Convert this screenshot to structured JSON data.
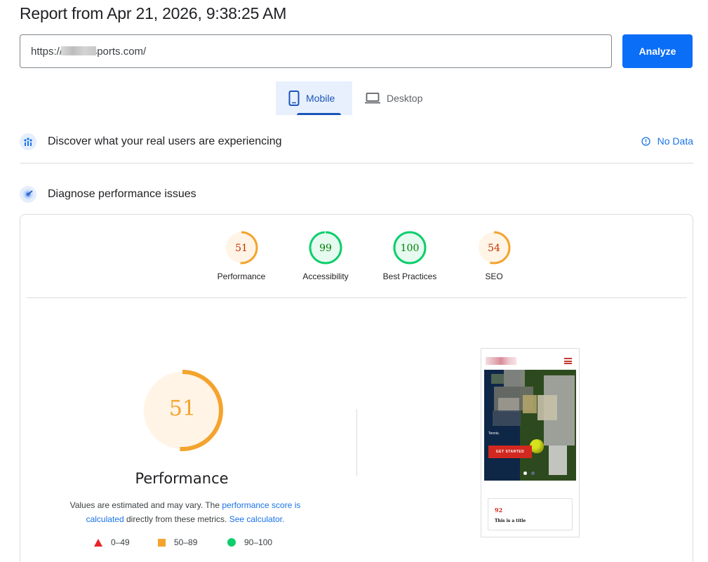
{
  "header": {
    "report_title": "Report from Apr 21, 2026, 9:38:25 AM"
  },
  "search": {
    "url_value": "https://          sports.com/",
    "analyze_label": "Analyze"
  },
  "device_tabs": [
    {
      "label": "Mobile",
      "icon": "phone-icon",
      "active": true
    },
    {
      "label": "Desktop",
      "icon": "laptop-icon",
      "active": false
    }
  ],
  "field_data": {
    "title": "Discover what your real users are experiencing",
    "status": "No Data",
    "icon": "users-chart-icon",
    "status_icon": "info-icon"
  },
  "lab_data": {
    "title": "Diagnose performance issues",
    "icon": "radar-icon"
  },
  "categories": [
    {
      "label": "Performance",
      "score": 51,
      "rating": "average"
    },
    {
      "label": "Accessibility",
      "score": 99,
      "rating": "pass"
    },
    {
      "label": "Best Practices",
      "score": 100,
      "rating": "pass"
    },
    {
      "label": "SEO",
      "score": 54,
      "rating": "average"
    }
  ],
  "performance": {
    "score": 51,
    "title": "Performance",
    "desc_prefix": "Values are estimated and may vary. The ",
    "desc_link1": "performance score is calculated",
    "desc_middle": " directly from these metrics. ",
    "desc_link2": "See calculator."
  },
  "legend": [
    {
      "range": "0–49",
      "shape": "triangle",
      "color": "#e8232b"
    },
    {
      "range": "50–89",
      "shape": "square",
      "color": "#f4a32e"
    },
    {
      "range": "90–100",
      "shape": "circle",
      "color": "#0cce6b"
    }
  ],
  "screenshot": {
    "cta_label": "GET STARTED",
    "small_text": "Tennis.",
    "card_number": "92",
    "card_title": "This is a title"
  },
  "colors": {
    "accent": "#1a73e8",
    "average": "#f4a32e",
    "average_bg": "#fff4e6",
    "pass": "#0cce6b",
    "pass_bg": "#e6faf0",
    "average_text": "#c33300",
    "pass_text": "#008000"
  }
}
